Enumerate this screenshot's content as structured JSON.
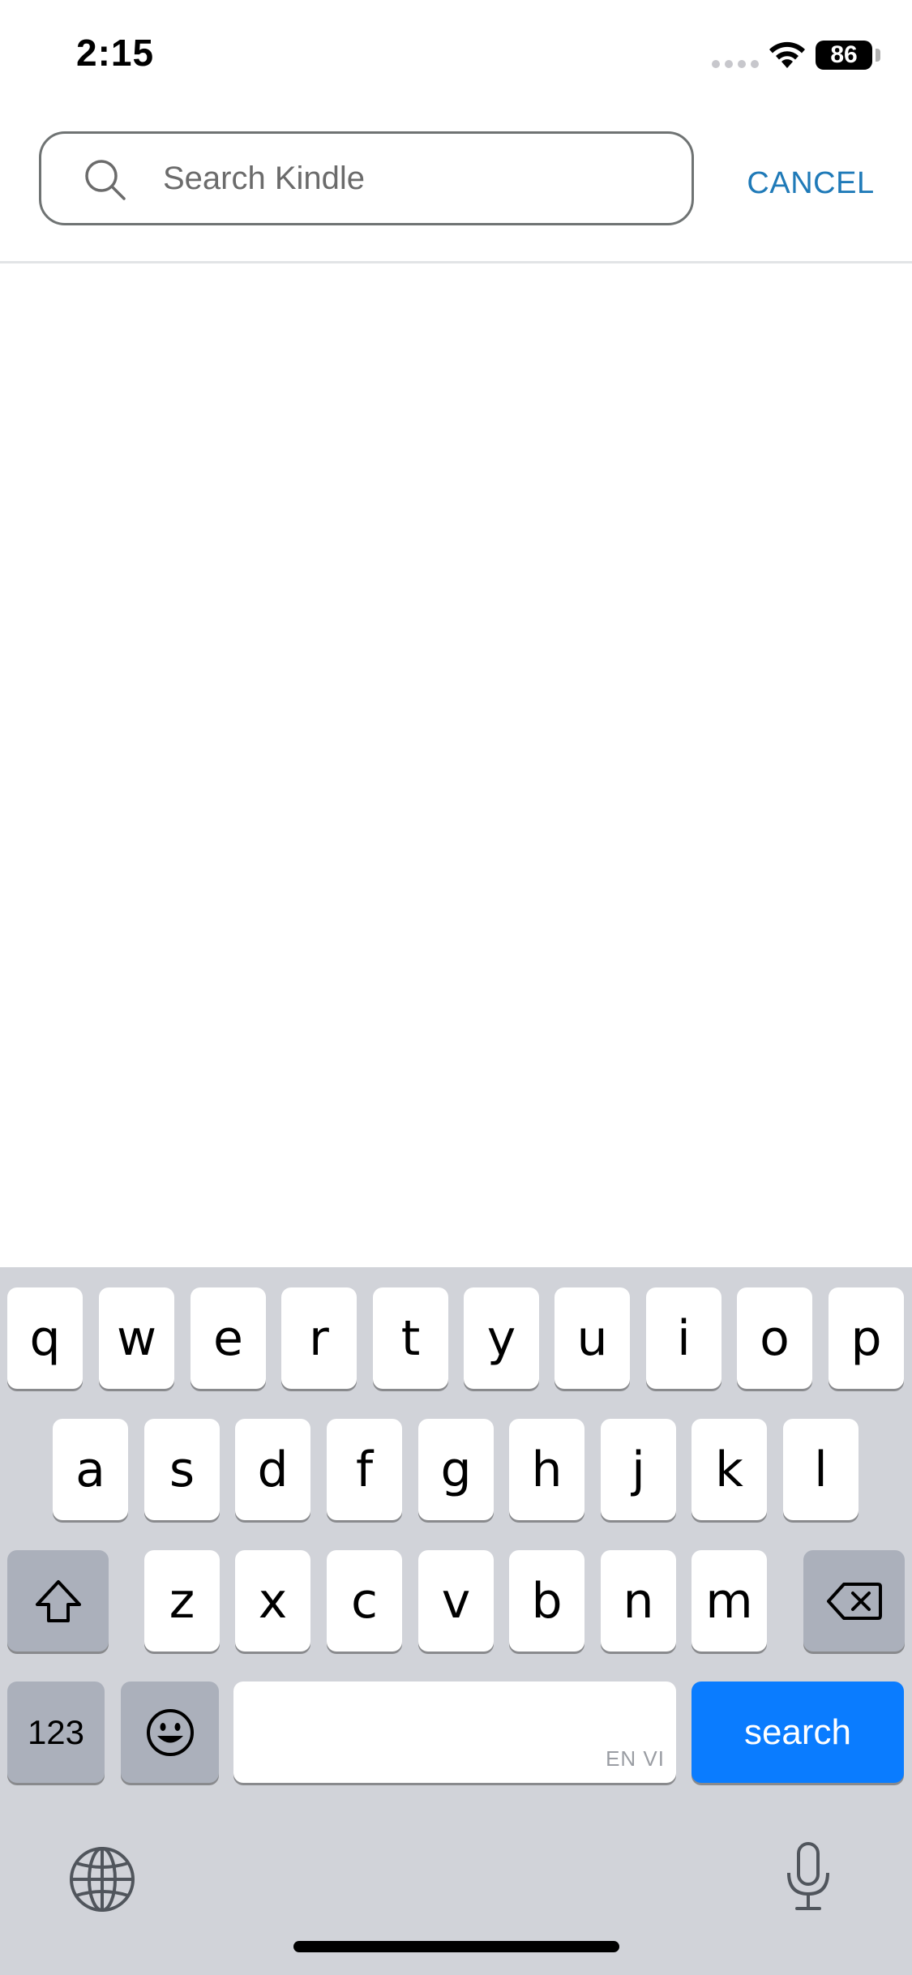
{
  "status_bar": {
    "time": "2:15",
    "battery": "86"
  },
  "search": {
    "placeholder": "Search Kindle",
    "value": "",
    "cancel_label": "CANCEL"
  },
  "keyboard": {
    "row1": [
      "q",
      "w",
      "e",
      "r",
      "t",
      "y",
      "u",
      "i",
      "o",
      "p"
    ],
    "row2": [
      "a",
      "s",
      "d",
      "f",
      "g",
      "h",
      "j",
      "k",
      "l"
    ],
    "row3": [
      "z",
      "x",
      "c",
      "v",
      "b",
      "n",
      "m"
    ],
    "numbers_label": "123",
    "space_lang": "EN VI",
    "search_label": "search"
  },
  "colors": {
    "accent": "#1f7ab8",
    "search_key": "#0a7cff",
    "keyboard_bg": "#d1d3d9"
  }
}
